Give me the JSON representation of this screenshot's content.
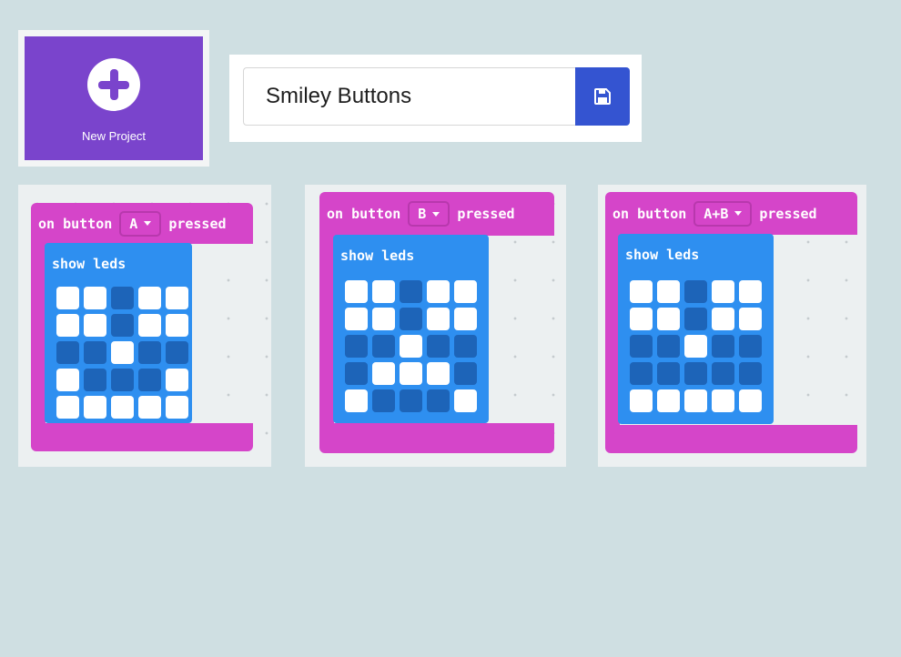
{
  "new_project": {
    "label": "New Project",
    "icon": "plus-icon"
  },
  "project_name": {
    "value": "Smiley Buttons",
    "save_icon": "save-icon"
  },
  "colors": {
    "event_block": "#d545c9",
    "basic_block": "#2e8ff0",
    "led_on": "#ffffff",
    "led_off": "#1d64b8",
    "accent": "#7a44cc",
    "save_button": "#3454d1"
  },
  "blocks": [
    {
      "prefix": "on button",
      "button": "A",
      "suffix": "pressed",
      "show_leds": "show leds",
      "leds": [
        [
          1,
          1,
          0,
          1,
          1
        ],
        [
          1,
          1,
          0,
          1,
          1
        ],
        [
          0,
          0,
          1,
          0,
          0
        ],
        [
          1,
          0,
          0,
          0,
          1
        ],
        [
          1,
          1,
          1,
          1,
          1
        ]
      ]
    },
    {
      "prefix": "on button",
      "button": "B",
      "suffix": "pressed",
      "show_leds": "show leds",
      "leds": [
        [
          1,
          1,
          0,
          1,
          1
        ],
        [
          1,
          1,
          0,
          1,
          1
        ],
        [
          0,
          0,
          1,
          0,
          0
        ],
        [
          0,
          1,
          1,
          1,
          0
        ],
        [
          1,
          0,
          0,
          0,
          1
        ]
      ]
    },
    {
      "prefix": "on button",
      "button": "A+B",
      "suffix": "pressed",
      "show_leds": "show leds",
      "leds": [
        [
          1,
          1,
          0,
          1,
          1
        ],
        [
          1,
          1,
          0,
          1,
          1
        ],
        [
          0,
          0,
          1,
          0,
          0
        ],
        [
          0,
          0,
          0,
          0,
          0
        ],
        [
          1,
          1,
          1,
          1,
          1
        ]
      ]
    }
  ]
}
